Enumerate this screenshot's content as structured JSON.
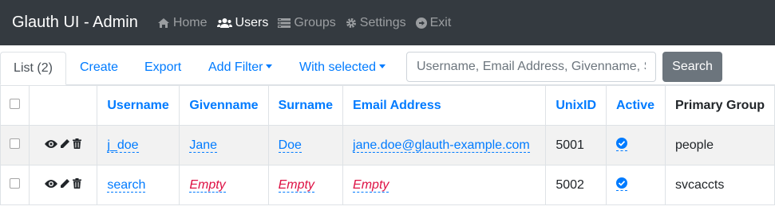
{
  "app": {
    "brand": "Glauth UI - Admin"
  },
  "nav": {
    "items": [
      {
        "label": "Home",
        "icon": "home-icon"
      },
      {
        "label": "Users",
        "icon": "users-icon",
        "active": true
      },
      {
        "label": "Groups",
        "icon": "groups-icon"
      },
      {
        "label": "Settings",
        "icon": "gear-icon"
      },
      {
        "label": "Exit",
        "icon": "exit-icon"
      }
    ]
  },
  "toolbar": {
    "list_tab": "List (2)",
    "create": "Create",
    "export": "Export",
    "add_filter": "Add Filter",
    "with_selected": "With selected",
    "search_placeholder": "Username, Email Address, Givenname, Surname",
    "search_button": "Search"
  },
  "table": {
    "columns": [
      "Username",
      "Givenname",
      "Surname",
      "Email Address",
      "UnixID",
      "Active",
      "Primary Group"
    ],
    "rows": [
      {
        "username": "j_doe",
        "givenname": "Jane",
        "surname": "Doe",
        "email": "jane.doe@glauth-example.com",
        "unixid": "5001",
        "active": true,
        "primary_group": "people"
      },
      {
        "username": "search",
        "givenname": "Empty",
        "surname": "Empty",
        "email": "Empty",
        "unixid": "5002",
        "active": true,
        "primary_group": "svcaccts"
      }
    ]
  },
  "colors": {
    "navbar": "#343a40",
    "link": "#007bff",
    "empty": "#dd1144",
    "button": "#6c757d"
  }
}
